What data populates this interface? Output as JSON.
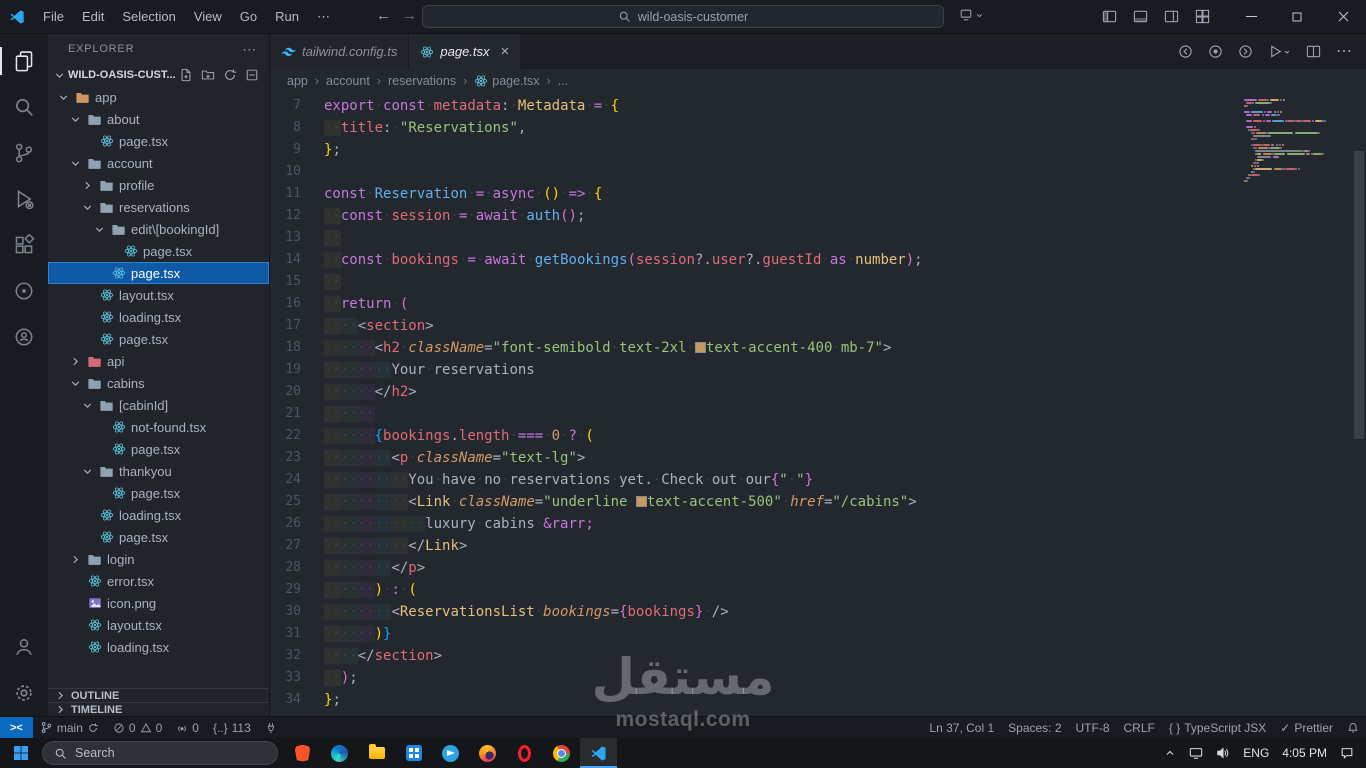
{
  "titlebar": {
    "menus": [
      "File",
      "Edit",
      "Selection",
      "View",
      "Go",
      "Run",
      "⋯"
    ],
    "search_text": "wild-oasis-customer"
  },
  "activitybar": {
    "items": [
      "explorer",
      "search",
      "source-control",
      "run-and-debug",
      "extensions",
      "remote-explorer",
      "live-share"
    ],
    "bottom": [
      "accounts",
      "settings"
    ],
    "active": "explorer"
  },
  "sidebar": {
    "title": "EXPLORER",
    "more_icon": "⋯",
    "project": "WILD-OASIS-CUST...",
    "tree": [
      {
        "label": "app",
        "depth": 0,
        "kind": "folder",
        "state": "open",
        "color": "#cf9662"
      },
      {
        "label": "about",
        "depth": 1,
        "kind": "folder",
        "state": "open",
        "color": "#8ea2b4"
      },
      {
        "label": "page.tsx",
        "depth": 2,
        "kind": "file",
        "icon": "react"
      },
      {
        "label": "account",
        "depth": 1,
        "kind": "folder",
        "state": "open",
        "color": "#8ea2b4"
      },
      {
        "label": "profile",
        "depth": 2,
        "kind": "folder",
        "state": "closed",
        "color": "#8ea2b4"
      },
      {
        "label": "reservations",
        "depth": 2,
        "kind": "folder",
        "state": "open",
        "color": "#8ea2b4"
      },
      {
        "label": "edit\\[bookingId]",
        "depth": 3,
        "kind": "folder",
        "state": "open",
        "color": "#8ea2b4"
      },
      {
        "label": "page.tsx",
        "depth": 4,
        "kind": "file",
        "icon": "react"
      },
      {
        "label": "page.tsx",
        "depth": 3,
        "kind": "file",
        "icon": "react",
        "selected": true
      },
      {
        "label": "layout.tsx",
        "depth": 2,
        "kind": "file",
        "icon": "react"
      },
      {
        "label": "loading.tsx",
        "depth": 2,
        "kind": "file",
        "icon": "react"
      },
      {
        "label": "page.tsx",
        "depth": 2,
        "kind": "file",
        "icon": "react"
      },
      {
        "label": "api",
        "depth": 1,
        "kind": "folder",
        "state": "closed",
        "color": "#d46a77"
      },
      {
        "label": "cabins",
        "depth": 1,
        "kind": "folder",
        "state": "open",
        "color": "#8ea2b4"
      },
      {
        "label": "[cabinId]",
        "depth": 2,
        "kind": "folder",
        "state": "open",
        "color": "#8ea2b4"
      },
      {
        "label": "not-found.tsx",
        "depth": 3,
        "kind": "file",
        "icon": "react"
      },
      {
        "label": "page.tsx",
        "depth": 3,
        "kind": "file",
        "icon": "react"
      },
      {
        "label": "thankyou",
        "depth": 2,
        "kind": "folder",
        "state": "open",
        "color": "#8ea2b4"
      },
      {
        "label": "page.tsx",
        "depth": 3,
        "kind": "file",
        "icon": "react"
      },
      {
        "label": "loading.tsx",
        "depth": 2,
        "kind": "file",
        "icon": "react"
      },
      {
        "label": "page.tsx",
        "depth": 2,
        "kind": "file",
        "icon": "react"
      },
      {
        "label": "login",
        "depth": 1,
        "kind": "folder",
        "state": "closed",
        "color": "#8ea2b4"
      },
      {
        "label": "error.tsx",
        "depth": 1,
        "kind": "file",
        "icon": "react"
      },
      {
        "label": "icon.png",
        "depth": 1,
        "kind": "file",
        "icon": "image"
      },
      {
        "label": "layout.tsx",
        "depth": 1,
        "kind": "file",
        "icon": "react"
      },
      {
        "label": "loading.tsx",
        "depth": 1,
        "kind": "file",
        "icon": "react"
      }
    ],
    "panels": [
      {
        "label": "OUTLINE"
      },
      {
        "label": "TIMELINE"
      }
    ]
  },
  "editor": {
    "tabs": [
      {
        "label": "tailwind.config.ts",
        "icon": "tailwind",
        "active": false
      },
      {
        "label": "page.tsx",
        "icon": "react",
        "active": true,
        "close": "×"
      }
    ],
    "breadcrumb": [
      {
        "label": "app"
      },
      {
        "label": "account"
      },
      {
        "label": "reservations"
      },
      {
        "label": "page.tsx",
        "icon": "react"
      },
      {
        "label": "..."
      }
    ],
    "code": [
      {
        "n": "7",
        "t": [
          [
            "kw",
            "export const"
          ],
          [
            "var",
            " metadata"
          ],
          [
            "pun",
            ":"
          ],
          [
            "type",
            " Metadata"
          ],
          [
            "op",
            " ="
          ],
          [
            "b1",
            " {"
          ]
        ]
      },
      {
        "n": "8",
        "t": [
          [
            "ind",
            "2"
          ],
          [
            "var",
            "title"
          ],
          [
            "pun",
            ":"
          ],
          [
            "str",
            " \"Reservations\""
          ],
          [
            "pun",
            ","
          ]
        ]
      },
      {
        "n": "9",
        "t": [
          [
            "b1",
            "}"
          ],
          [
            "pun",
            ";"
          ]
        ]
      },
      {
        "n": "10",
        "t": []
      },
      {
        "n": "11",
        "t": [
          [
            "kw",
            "const"
          ],
          [
            "fn",
            " Reservation"
          ],
          [
            "op",
            " ="
          ],
          [
            "kw",
            " async"
          ],
          [
            "b1",
            " ()"
          ],
          [
            "op",
            " =>"
          ],
          [
            "b1",
            " {"
          ]
        ]
      },
      {
        "n": "12",
        "t": [
          [
            "ind",
            "2"
          ],
          [
            "kw",
            "const"
          ],
          [
            "var",
            " session"
          ],
          [
            "op",
            " ="
          ],
          [
            "kw",
            " await"
          ],
          [
            "fn",
            " auth"
          ],
          [
            "b2",
            "()"
          ],
          [
            "pun",
            ";"
          ]
        ]
      },
      {
        "n": "13",
        "t": [
          [
            "ind",
            "2"
          ]
        ]
      },
      {
        "n": "14",
        "t": [
          [
            "ind",
            "2"
          ],
          [
            "kw",
            "const"
          ],
          [
            "var",
            " bookings"
          ],
          [
            "op",
            " ="
          ],
          [
            "kw",
            " await"
          ],
          [
            "fn",
            " getBookings"
          ],
          [
            "b2",
            "("
          ],
          [
            "var",
            "session"
          ],
          [
            "pun",
            "?."
          ],
          [
            "var",
            "user"
          ],
          [
            "pun",
            "?."
          ],
          [
            "var",
            "guestId"
          ],
          [
            "kw",
            " as"
          ],
          [
            "type",
            " number"
          ],
          [
            "b2",
            ")"
          ],
          [
            "pun",
            ";"
          ]
        ]
      },
      {
        "n": "15",
        "t": [
          [
            "ind",
            "2"
          ]
        ]
      },
      {
        "n": "16",
        "t": [
          [
            "ind",
            "2"
          ],
          [
            "kw",
            "return"
          ],
          [
            "b2",
            " ("
          ]
        ]
      },
      {
        "n": "17",
        "t": [
          [
            "ind",
            "4"
          ],
          [
            "pun",
            "<"
          ],
          [
            "tag",
            "section"
          ],
          [
            "pun",
            ">"
          ]
        ]
      },
      {
        "n": "18",
        "t": [
          [
            "ind",
            "6"
          ],
          [
            "pun",
            "<"
          ],
          [
            "tag",
            "h2"
          ],
          [
            "attr",
            " className"
          ],
          [
            "pun",
            "="
          ],
          [
            "str",
            "\"font-semibold text-2xl "
          ],
          [
            "swatch",
            "#c69963"
          ],
          [
            "str",
            "text-accent-400 mb-7\""
          ],
          [
            "pun",
            ">"
          ]
        ]
      },
      {
        "n": "19",
        "t": [
          [
            "ind",
            "8"
          ],
          [
            "txt",
            "Your reservations"
          ]
        ]
      },
      {
        "n": "20",
        "t": [
          [
            "ind",
            "6"
          ],
          [
            "pun",
            "</"
          ],
          [
            "tag",
            "h2"
          ],
          [
            "pun",
            ">"
          ]
        ]
      },
      {
        "n": "21",
        "t": [
          [
            "ind",
            "6"
          ]
        ]
      },
      {
        "n": "22",
        "t": [
          [
            "ind",
            "6"
          ],
          [
            "b3",
            "{"
          ],
          [
            "var",
            "bookings"
          ],
          [
            "pun",
            "."
          ],
          [
            "var",
            "length"
          ],
          [
            "op",
            " ==="
          ],
          [
            "num",
            " 0"
          ],
          [
            "op",
            " ?"
          ],
          [
            "b1",
            " ("
          ]
        ]
      },
      {
        "n": "23",
        "t": [
          [
            "ind",
            "8"
          ],
          [
            "pun",
            "<"
          ],
          [
            "tag",
            "p"
          ],
          [
            "attr",
            " className"
          ],
          [
            "pun",
            "="
          ],
          [
            "str",
            "\"text-lg\""
          ],
          [
            "pun",
            ">"
          ]
        ]
      },
      {
        "n": "24",
        "t": [
          [
            "ind",
            "10"
          ],
          [
            "txt",
            "You have no reservations yet. Check out our"
          ],
          [
            "b2",
            "{"
          ],
          [
            "str",
            "\" \""
          ],
          [
            "b2",
            "}"
          ]
        ]
      },
      {
        "n": "25",
        "t": [
          [
            "ind",
            "10"
          ],
          [
            "pun",
            "<"
          ],
          [
            "comp",
            "Link"
          ],
          [
            "attr",
            " className"
          ],
          [
            "pun",
            "="
          ],
          [
            "str",
            "\"underline "
          ],
          [
            "swatch",
            "#c69963"
          ],
          [
            "str",
            "text-accent-500\""
          ],
          [
            "attr",
            " href"
          ],
          [
            "pun",
            "="
          ],
          [
            "str",
            "\"/cabins\""
          ],
          [
            "pun",
            ">"
          ]
        ]
      },
      {
        "n": "26",
        "t": [
          [
            "ind",
            "12"
          ],
          [
            "txt",
            "luxury cabins"
          ],
          [
            "op",
            " &rarr;"
          ]
        ]
      },
      {
        "n": "27",
        "t": [
          [
            "ind",
            "10"
          ],
          [
            "pun",
            "</"
          ],
          [
            "comp",
            "Link"
          ],
          [
            "pun",
            ">"
          ]
        ]
      },
      {
        "n": "28",
        "t": [
          [
            "ind",
            "8"
          ],
          [
            "pun",
            "</"
          ],
          [
            "tag",
            "p"
          ],
          [
            "pun",
            ">"
          ]
        ]
      },
      {
        "n": "29",
        "t": [
          [
            "ind",
            "6"
          ],
          [
            "b1",
            ")"
          ],
          [
            "op",
            " :"
          ],
          [
            "b1",
            " ("
          ]
        ]
      },
      {
        "n": "30",
        "t": [
          [
            "ind",
            "8"
          ],
          [
            "pun",
            "<"
          ],
          [
            "comp",
            "ReservationsList"
          ],
          [
            "attr",
            " bookings"
          ],
          [
            "pun",
            "="
          ],
          [
            "b2",
            "{"
          ],
          [
            "var",
            "bookings"
          ],
          [
            "b2",
            "}"
          ],
          [
            "pun",
            " />"
          ]
        ]
      },
      {
        "n": "31",
        "t": [
          [
            "ind",
            "6"
          ],
          [
            "b1",
            ")"
          ],
          [
            "b3",
            "}"
          ]
        ]
      },
      {
        "n": "32",
        "t": [
          [
            "ind",
            "4"
          ],
          [
            "pun",
            "</"
          ],
          [
            "tag",
            "section"
          ],
          [
            "pun",
            ">"
          ]
        ]
      },
      {
        "n": "33",
        "t": [
          [
            "ind",
            "2"
          ],
          [
            "b2",
            ")"
          ],
          [
            "pun",
            ";"
          ]
        ]
      },
      {
        "n": "34",
        "t": [
          [
            "b1",
            "}"
          ],
          [
            "pun",
            ";"
          ]
        ]
      }
    ]
  },
  "statusbar": {
    "remote_label": "><",
    "branch": "main",
    "errors": "0",
    "warnings": "0",
    "ports": "0",
    "counter_icon": "{..}",
    "counter": "113",
    "line_col": "Ln 37, Col 1",
    "indentation": "Spaces: 2",
    "encoding": "UTF-8",
    "eol": "CRLF",
    "language_icon": "{ }",
    "language": "TypeScript JSX",
    "formatter_check": "✓",
    "formatter": "Prettier"
  },
  "taskbar": {
    "search_placeholder": "Search",
    "apps": [
      "brave",
      "edge",
      "explorer",
      "store",
      "telegram",
      "firefox",
      "opera",
      "chrome",
      "vscode"
    ],
    "active_app": "vscode",
    "language": "ENG",
    "time": "4:05 PM"
  },
  "watermark": {
    "arabic": "مستقل",
    "domain": "mostaql.com"
  }
}
